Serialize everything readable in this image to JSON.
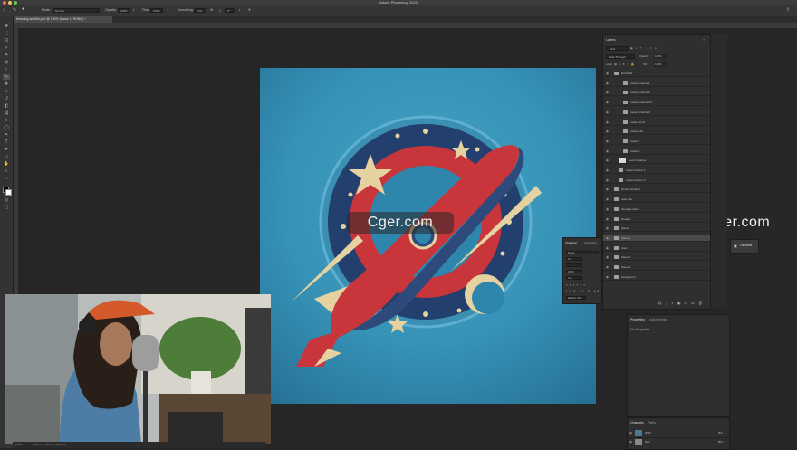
{
  "app": {
    "title": "Adobe Photoshop 2023",
    "document_tab": "texturing-workflo.psd @ 100% (frame 1, RGB/8) *"
  },
  "options_bar": {
    "mode_label": "Mode:",
    "mode_value": "Normal",
    "opacity_label": "Opacity:",
    "opacity_value": "100%",
    "flow_label": "Flow:",
    "flow_value": "100%",
    "smoothing_label": "Smoothing:",
    "smoothing_value": "10%",
    "angle_value": "0°"
  },
  "layers_panel": {
    "tab": "Layers",
    "kind_filter": "Kind",
    "blend_mode": "Pass Through",
    "opacity_label": "Opacity:",
    "opacity_value": "100%",
    "lock_label": "Lock:",
    "fill_label": "Fill:",
    "fill_value": "100%",
    "layers": [
      {
        "name": "ROCKET",
        "type": "group",
        "indent": 0
      },
      {
        "name": "rocket window 1",
        "type": "group",
        "indent": 2
      },
      {
        "name": "rocket window 2",
        "type": "group",
        "indent": 2
      },
      {
        "name": "rocket window 2.5",
        "type": "group",
        "indent": 2
      },
      {
        "name": "rocket window 3",
        "type": "group",
        "indent": 2
      },
      {
        "name": "rocket shine",
        "type": "group",
        "indent": 2
      },
      {
        "name": "rocket half",
        "type": "group",
        "indent": 2
      },
      {
        "name": "rocket 7",
        "type": "group",
        "indent": 2
      },
      {
        "name": "rocket 3",
        "type": "group",
        "indent": 2
      },
      {
        "name": "pencil shadow",
        "type": "pixel",
        "indent": 1
      },
      {
        "name": "rocket booster 1",
        "type": "group",
        "indent": 1
      },
      {
        "name": "rocket booster 2",
        "type": "group",
        "indent": 1
      },
      {
        "name": "Rocket Shadow",
        "type": "group",
        "indent": 0
      },
      {
        "name": "stars star",
        "type": "group",
        "indent": 0
      },
      {
        "name": "shooting stars",
        "type": "group",
        "indent": 0
      },
      {
        "name": "shadow",
        "type": "group",
        "indent": 0
      },
      {
        "name": "planet",
        "type": "group",
        "indent": 0
      },
      {
        "name": "frame 1",
        "type": "group",
        "indent": 0,
        "selected": true
      },
      {
        "name": "stars",
        "type": "group",
        "indent": 0
      },
      {
        "name": "frame 2",
        "type": "group",
        "indent": 0
      },
      {
        "name": "frame 3",
        "type": "group",
        "indent": 0
      },
      {
        "name": "background",
        "type": "group",
        "indent": 0
      }
    ]
  },
  "character_panel": {
    "tab_character": "Character",
    "tab_paragraph": "Paragraph",
    "font_family": "Futura",
    "font_size": "6 pt",
    "tracking": "100%",
    "baseline": "0 pt",
    "language": "English: USA"
  },
  "libraries_panel": {
    "label": "Libraries"
  },
  "properties_panel": {
    "tab_properties": "Properties",
    "tab_adjustments": "Adjustments",
    "message": "No Properties"
  },
  "channels_panel": {
    "tab_channels": "Channels",
    "tab_paths": "Paths",
    "rows": [
      {
        "name": "RGB",
        "shortcut": "⌘2"
      },
      {
        "name": "Red",
        "shortcut": "⌘3"
      }
    ]
  },
  "status_bar": {
    "zoom": "100%",
    "doc_size": "1037 px x 1037 px (300 ppi)"
  },
  "watermark": {
    "text": "Cger.com"
  },
  "colors": {
    "canvas_bg": "#3692b6",
    "rocket_red": "#c8363c",
    "rocket_blue": "#2d4a7a",
    "cream": "#e6d2a0",
    "ring_navy": "#233f6e",
    "selected_layer": "#4a4a4a"
  }
}
